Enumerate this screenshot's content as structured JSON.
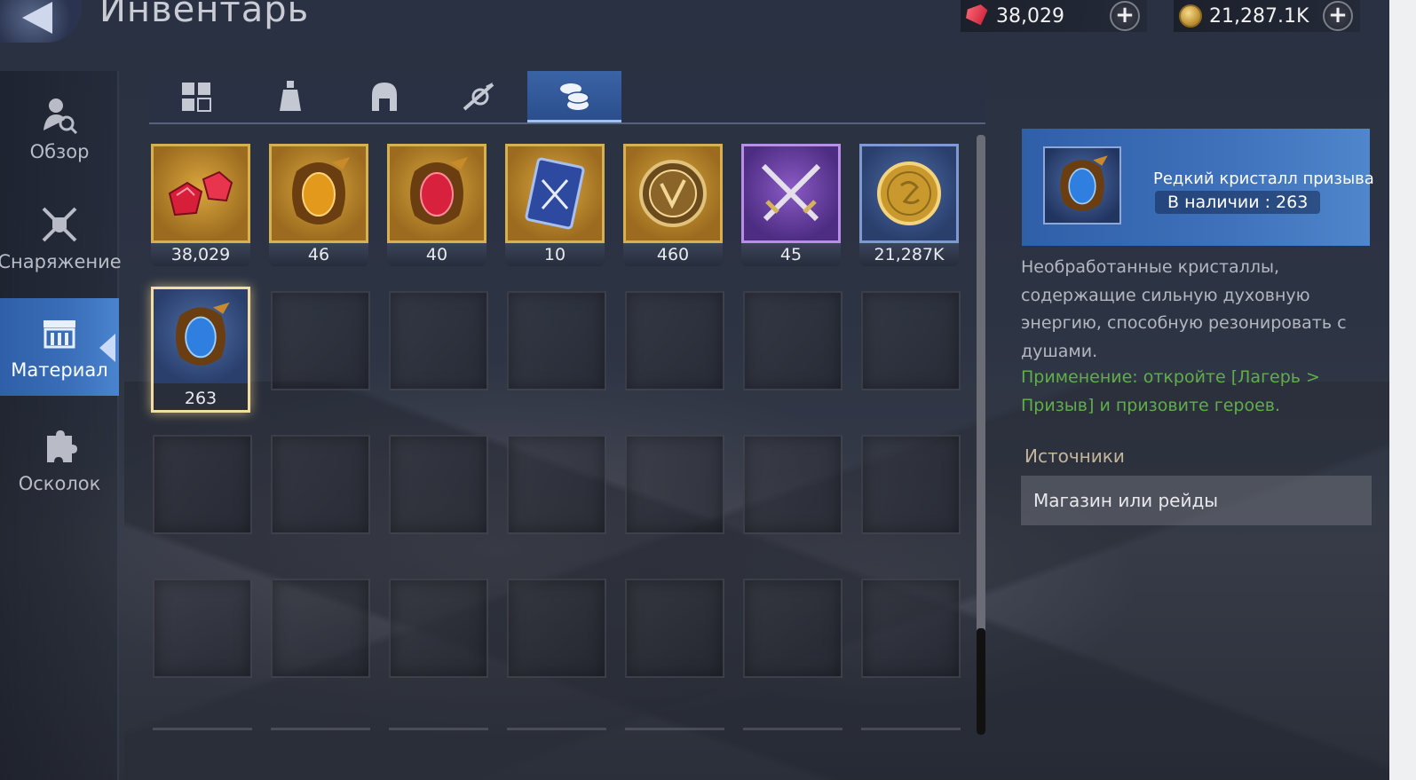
{
  "header": {
    "title": "Инвентарь",
    "back_icon": "back-arrow-icon",
    "currencies": [
      {
        "icon": "ruby-icon",
        "value": "38,029"
      },
      {
        "icon": "gold-coin-icon",
        "value": "21,287.1K"
      }
    ]
  },
  "sidebar": {
    "items": [
      {
        "label": "Обзор",
        "icon": "overview-icon",
        "active": false
      },
      {
        "label": "Снаряжение",
        "icon": "equipment-icon",
        "active": false
      },
      {
        "label": "Материал",
        "icon": "material-icon",
        "active": true
      },
      {
        "label": "Осколок",
        "icon": "shard-icon",
        "active": false
      }
    ]
  },
  "tabs": [
    {
      "icon": "grid-icon",
      "active": false
    },
    {
      "icon": "potion-icon",
      "active": false
    },
    {
      "icon": "helmet-icon",
      "active": false
    },
    {
      "icon": "artifact-icon",
      "active": false
    },
    {
      "icon": "coins-icon",
      "active": true
    }
  ],
  "items": [
    {
      "count": "38,029",
      "icon": "ruby-gems-icon",
      "rarity": "gold"
    },
    {
      "count": "46",
      "icon": "gold-crystal-icon",
      "rarity": "gold"
    },
    {
      "count": "40",
      "icon": "red-crystal-icon",
      "rarity": "gold"
    },
    {
      "count": "10",
      "icon": "sword-card-icon",
      "rarity": "gold"
    },
    {
      "count": "460",
      "icon": "emblem-coin-icon",
      "rarity": "gold"
    },
    {
      "count": "45",
      "icon": "crossed-swords-icon",
      "rarity": "purple"
    },
    {
      "count": "21,287K",
      "icon": "gold-coin-icon",
      "rarity": "blue"
    },
    {
      "count": "263",
      "icon": "blue-crystal-icon",
      "rarity": "blue",
      "selected": true
    }
  ],
  "detail": {
    "name": "Редкий кристалл призыва",
    "quantity": "В наличии : 263",
    "icon": "blue-crystal-icon",
    "description": "Необработанные кристаллы, содержащие сильную духовную энергию, способную резонировать с душами.",
    "usage": "Применение: откройте [Лагерь > Призыв] и призовите героев.",
    "sources_title": "Источники",
    "sources_value": "Магазин или рейды"
  },
  "colors": {
    "accent_blue": "#3b6fba",
    "gold_frame": "#d7b04f",
    "usage_green": "#5fae4a"
  }
}
